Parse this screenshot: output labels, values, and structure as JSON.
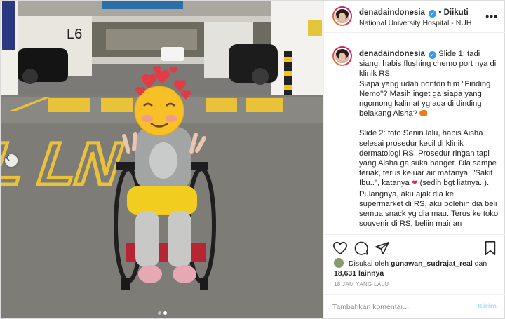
{
  "post": {
    "username": "denadaindonesia",
    "follow_status": "Diikuti",
    "location": "National University Hospital - NUH",
    "separator": "•"
  },
  "photo": {
    "sign_text": "L6",
    "floor_text": "SL LN"
  },
  "caption": {
    "p1": "Slide 1: tadi siang, habis flushing chemo port nya di klinik RS.",
    "p2": "Siapa yang udah nonton film \"Finding Nemo\"? Masih inget ga siapa yang ngomong kalimat yg ada di dinding belakang Aisha?",
    "p3": "Slide 2: foto Senin lalu, habis Aisha selesai prosedur kecil di klinik dermatologi RS. Prosedur ringan tapi yang Aisha ga suka banget. Dia sampe teriak, terus keluar air matanya. \"Sakit Ibu..\", katanya",
    "p3_tail": "(sedih bgt liatnya..).",
    "p4": "Pulangnya, aku ajak dia ke supermarket di RS, aku bolehin dia beli semua snack yg dia mau. Terus ke toko souvenir di RS, beliin mainan"
  },
  "likes": {
    "prefix": "Disukai oleh",
    "user": "gunawan_sudrajat_real",
    "and": "dan",
    "count": "18,631 lainnya"
  },
  "timestamp": "18 JAM YANG LALU",
  "comment": {
    "placeholder": "Tambahkan komentar...",
    "post_label": "Kirim"
  },
  "carousel": {
    "slides": 2,
    "active": 1
  },
  "colors": {
    "verified": "#3897f0",
    "post_button_disabled": "#b2dffc",
    "heart_emoji": "#e0245e"
  },
  "icons": [
    "more-icon",
    "heart-icon",
    "comment-icon",
    "share-icon",
    "bookmark-icon",
    "chevron-left-icon",
    "verified-icon"
  ]
}
